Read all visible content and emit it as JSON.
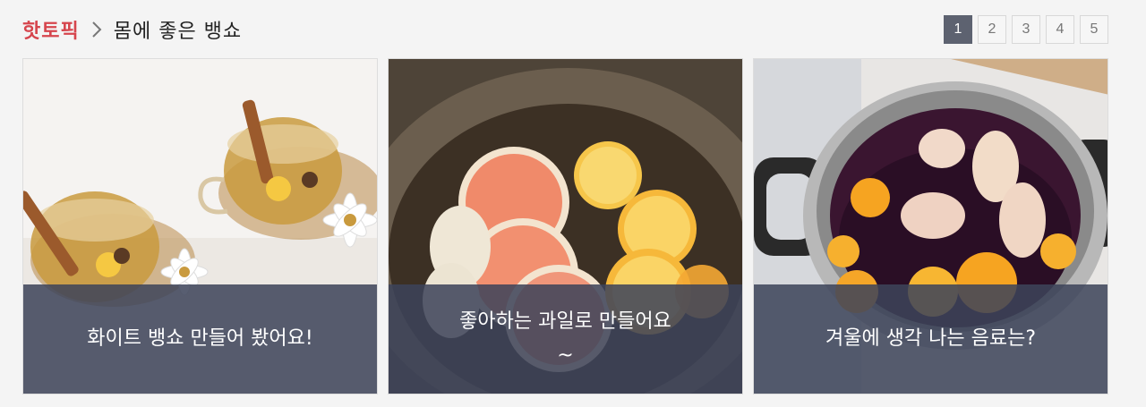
{
  "header": {
    "section_label": "핫토픽",
    "breadcrumb_title": "몸에 좋은 뱅쇼"
  },
  "pagination": {
    "pages": [
      "1",
      "2",
      "3",
      "4",
      "5"
    ],
    "current": "1"
  },
  "cards": [
    {
      "caption": "화이트 뱅쇼 만들어 봤어요!",
      "image": "white-vin-chaud-tea-cups"
    },
    {
      "caption": "좋아하는 과일로 만들어요~",
      "image": "citrus-slices-in-pot"
    },
    {
      "caption": "겨울에 생각 나는 음료는?",
      "image": "mulled-wine-pot"
    }
  ],
  "colors": {
    "accent": "#d6454d",
    "caption_overlay": "#3d445a",
    "active_page": "#5d6270"
  }
}
